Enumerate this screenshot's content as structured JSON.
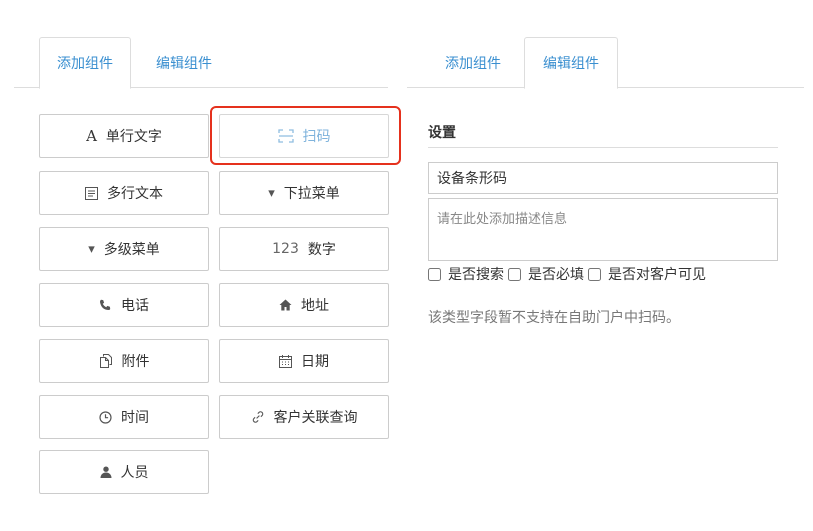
{
  "left_tabs": [
    {
      "label": "添加组件",
      "active": true
    },
    {
      "label": "编辑组件",
      "active": false
    }
  ],
  "right_tabs": [
    {
      "label": "添加组件",
      "active": false
    },
    {
      "label": "编辑组件",
      "active": true
    }
  ],
  "components": [
    {
      "label": "单行文字",
      "icon": "A",
      "icon_name": "text-a-icon"
    },
    {
      "label": "扫码",
      "icon": "scan-frame",
      "icon_name": "scan-icon",
      "selected": true
    },
    {
      "label": "多行文本",
      "icon": "textarea",
      "icon_name": "textarea-icon"
    },
    {
      "label": "下拉菜单",
      "icon": "▾",
      "icon_name": "caret-down-icon"
    },
    {
      "label": "多级菜单",
      "icon": "▾",
      "icon_name": "caret-down-icon"
    },
    {
      "label": "数字",
      "icon": "123",
      "icon_name": "number-icon"
    },
    {
      "label": "电话",
      "icon": "phone",
      "icon_name": "phone-icon"
    },
    {
      "label": "地址",
      "icon": "home",
      "icon_name": "home-icon"
    },
    {
      "label": "附件",
      "icon": "files",
      "icon_name": "attachment-icon"
    },
    {
      "label": "日期",
      "icon": "calendar",
      "icon_name": "calendar-icon"
    },
    {
      "label": "时间",
      "icon": "clock",
      "icon_name": "clock-icon"
    },
    {
      "label": "客户关联查询",
      "icon": "link",
      "icon_name": "link-icon"
    },
    {
      "label": "人员",
      "icon": "person",
      "icon_name": "person-icon"
    }
  ],
  "settings": {
    "title": "设置",
    "name_value": "设备条形码",
    "desc_placeholder": "请在此处添加描述信息",
    "checkboxes": [
      {
        "label": "是否搜索",
        "checked": false
      },
      {
        "label": "是否必填",
        "checked": false
      },
      {
        "label": "是否对客户可见",
        "checked": false
      }
    ],
    "note": "该类型字段暂不支持在自助门户中扫码。"
  },
  "colors": {
    "accent": "#3a8fd0",
    "selection_outline": "#e5311d",
    "border": "#cccccc"
  }
}
